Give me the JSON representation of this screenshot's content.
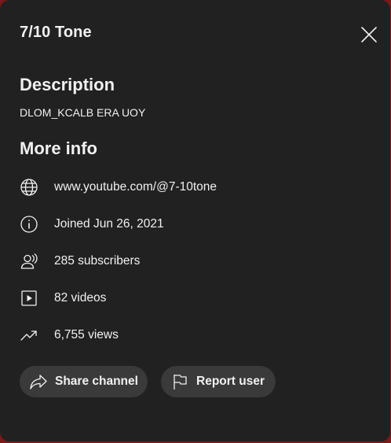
{
  "dialog": {
    "title": "7/10 Tone",
    "description_heading": "Description",
    "description": "DLOM_KCALB ERA UOY",
    "more_info_heading": "More info",
    "info": {
      "url": "www.youtube.com/@7-10tone",
      "joined": "Joined Jun 26, 2021",
      "subscribers": "285 subscribers",
      "videos": "82 videos",
      "views": "6,755 views"
    },
    "actions": {
      "share_label": "Share channel",
      "report_label": "Report user"
    },
    "icons": {
      "close": "close-icon",
      "url": "globe-icon",
      "joined": "info-icon",
      "subscribers": "person-radiate-icon",
      "videos": "play-square-icon",
      "views": "trending-icon",
      "share": "share-arrow-icon",
      "report": "flag-icon"
    }
  },
  "colors": {
    "background": "#212121",
    "text": "#f1f1f1",
    "button": "#3a3a3a",
    "page_edge": "#7a1a1a"
  }
}
